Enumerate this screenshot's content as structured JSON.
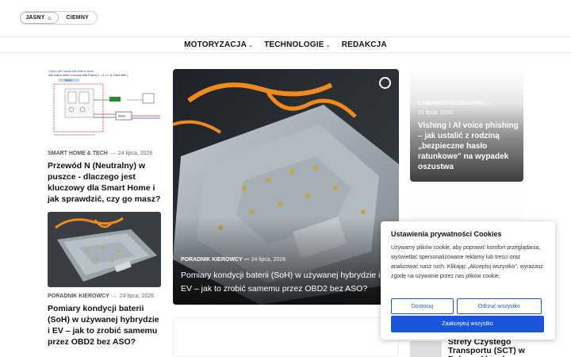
{
  "theme_toggle": {
    "light_label": "JASNY",
    "light_icon": "sun-icon",
    "dark_label": "CIEMNY"
  },
  "nav": {
    "items": [
      {
        "label": "MOTORYZACJA",
        "has_dropdown": true
      },
      {
        "label": "TECHNOLOGIE",
        "has_dropdown": true
      },
      {
        "label": "REDAKCJA",
        "has_dropdown": false
      }
    ]
  },
  "left_posts": [
    {
      "category": "SMART HOME & TECH",
      "date": "24 lipca, 2026",
      "title": "Przewód N (Neutralny) w puszce - dlaczego jest kluczowy dla Smart Home i jak sprawdzić, czy go masz?",
      "diagram": {
        "caption_1": "Option with blinds with built-in driver",
        "caption_2": "with built-in driver is a motor with 5 wires( L, L1, L2, N, Earth Wire ).",
        "label_motor": "Motor",
        "label_motor2": "Motor"
      }
    },
    {
      "category": "PORADNIK KIEROWCY",
      "date": "24 lipca, 2026",
      "title": "Pomiary kondycji baterii (SoH) w używanej hybrydzie i EV – jak to zrobić samemu przez OBD2 bez ASO?"
    }
  ],
  "hero": {
    "category": "PORADNIK KIEROWCY",
    "date": "24 lipca, 2026",
    "title": "Pomiary kondycji baterii (SoH) w używanej hybrydzie i EV – jak to zrobić samemu przez OBD2 bez ASO?"
  },
  "right_post": {
    "category": "CYBERBEZPIECZEŃSTWO",
    "date": "22 lipca, 2026",
    "title": "Vishing i AI voice phishing – jak ustalić z rodziną „bezpieczne hasło ratunkowe\" na wypadek oszustwa"
  },
  "partial_post": {
    "title": "Strefy Czystego Transportu (SCT) w Polsce. Aktualny"
  },
  "cookie_banner": {
    "title": "Ustawienia prywatności Cookies",
    "text": "Używamy plików cookie, aby poprawić komfort przeglądania, wyświetlać spersonalizowane reklamy lub treści oraz analizować nasz ruch. Klikając „Akceptuj wszystko\", wyrażasz zgodę na używanie przez nas plików cookie.",
    "deny_label": "Dostosuj",
    "reject_label": "Odrzuć wszystko",
    "accept_label": "Zaakceptuj wszystko"
  },
  "colors": {
    "accent": "#1a56db",
    "wire_orange": "#f08a1c"
  },
  "separator": "—"
}
